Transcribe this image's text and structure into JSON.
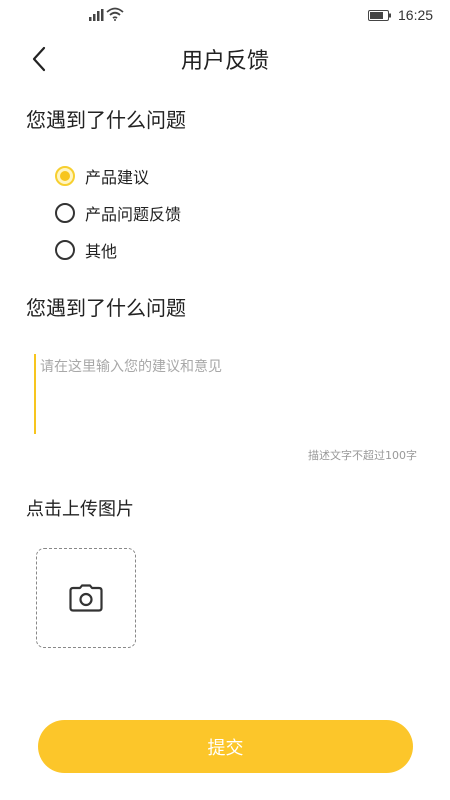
{
  "status_bar": {
    "time": "16:25",
    "icons": [
      "signal-icon",
      "wifi-icon",
      "battery-icon"
    ]
  },
  "header": {
    "title": "用户反馈",
    "back_icon": "chevron-left-icon"
  },
  "question": {
    "title": "您遇到了什么问题",
    "options": [
      {
        "label": "产品建议",
        "selected": true
      },
      {
        "label": "产品问题反馈",
        "selected": false
      },
      {
        "label": "其他",
        "selected": false
      }
    ]
  },
  "description": {
    "title": "您遇到了什么问题",
    "value": "",
    "placeholder": "请在这里输入您的建议和意见",
    "hint": "描述文字不超过100字"
  },
  "upload": {
    "title": "点击上传图片",
    "icon": "camera-icon"
  },
  "submit": {
    "label": "提交"
  },
  "colors": {
    "accent": "#fcc62a",
    "radio_selected": "#f7c51e",
    "text": "#222222",
    "hint": "#999999"
  }
}
